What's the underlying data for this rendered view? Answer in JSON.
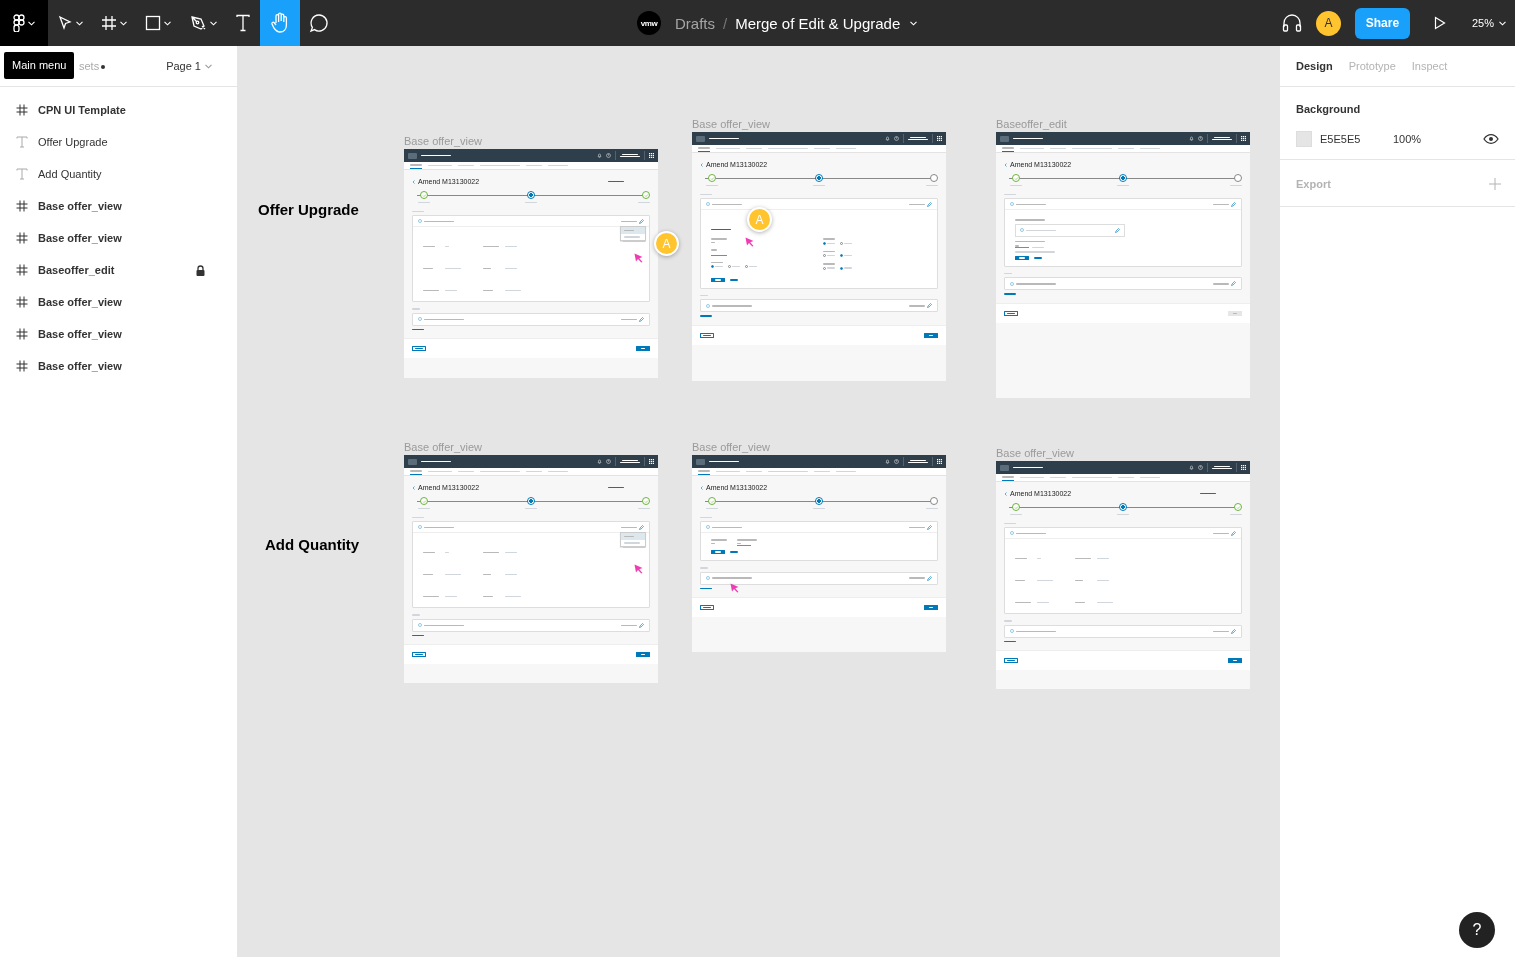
{
  "toolbar": {
    "tools": [
      {
        "kind": "logo",
        "caret": true,
        "selected": false
      },
      {
        "kind": "move",
        "caret": true,
        "selected": false
      },
      {
        "kind": "frame",
        "caret": true,
        "selected": false
      },
      {
        "kind": "shape",
        "caret": true,
        "selected": false
      },
      {
        "kind": "pen",
        "caret": true,
        "selected": false
      },
      {
        "kind": "text",
        "caret": false,
        "selected": false
      },
      {
        "kind": "hand",
        "caret": false,
        "selected": true
      },
      {
        "kind": "comment",
        "caret": false,
        "selected": false
      }
    ],
    "team_logo": "vmw",
    "breadcrumb": "Drafts",
    "separator": "/",
    "file_name": "Merge of Edit & Upgrade",
    "avatar": "A",
    "share": "Share",
    "zoom": "25%"
  },
  "tooltip": "Main menu",
  "left_panel": {
    "tab": "sets",
    "page": "Page 1",
    "layers": [
      {
        "kind": "frame",
        "name": "CPN UI Template",
        "locked": false
      },
      {
        "kind": "text",
        "name": "Offer Upgrade",
        "locked": false
      },
      {
        "kind": "text",
        "name": "Add Quantity",
        "locked": false
      },
      {
        "kind": "frame",
        "name": "Base offer_view",
        "locked": false
      },
      {
        "kind": "frame",
        "name": "Base offer_view",
        "locked": false
      },
      {
        "kind": "frame",
        "name": "Baseoffer_edit",
        "locked": true
      },
      {
        "kind": "frame",
        "name": "Base offer_view",
        "locked": false
      },
      {
        "kind": "frame",
        "name": "Base offer_view",
        "locked": false
      },
      {
        "kind": "frame",
        "name": "Base offer_view",
        "locked": false
      }
    ]
  },
  "canvas": {
    "labels": [
      "Offer Upgrade",
      "Add Quantity"
    ],
    "frames": [
      {
        "label": "Base offer_view",
        "title": "Amend M13130022",
        "add_link": true,
        "steps": [
          {
            "complete": true,
            "selected": false
          },
          {
            "complete": false,
            "selected": true
          },
          {
            "complete": true,
            "selected": false
          }
        ],
        "body": {
          "kind": "details"
        },
        "menu_open": true,
        "pointer": true,
        "badge": "A",
        "next_disabled": false
      },
      {
        "label": "Base offer_view",
        "title": "Amend M13130022",
        "add_link": false,
        "steps": [
          {
            "complete": true,
            "selected": false
          },
          {
            "complete": false,
            "selected": true
          },
          {
            "complete": false,
            "selected": false
          }
        ],
        "body": {
          "kind": "change-offer"
        },
        "menu_open": false,
        "pointer": true,
        "badge": "A",
        "next_disabled": false
      },
      {
        "label": "Baseoffer_edit",
        "title": "Amend M13130022",
        "add_link": false,
        "steps": [
          {
            "complete": true,
            "selected": false
          },
          {
            "complete": false,
            "selected": true
          },
          {
            "complete": false,
            "selected": false
          }
        ],
        "body": {
          "kind": "upgrade"
        },
        "menu_open": false,
        "pointer": false,
        "next_disabled": true
      },
      {
        "label": "Base offer_view",
        "title": "Amend M13130022",
        "add_link": true,
        "steps": [
          {
            "complete": true,
            "selected": false
          },
          {
            "complete": false,
            "selected": true
          },
          {
            "complete": true,
            "selected": false
          }
        ],
        "body": {
          "kind": "details"
        },
        "menu_open": true,
        "pointer": true,
        "next_disabled": false
      },
      {
        "label": "Base offer_view",
        "title": "Amend M13130022",
        "add_link": false,
        "steps": [
          {
            "complete": true,
            "selected": false
          },
          {
            "complete": false,
            "selected": true
          },
          {
            "complete": false,
            "selected": false
          }
        ],
        "body": {
          "kind": "add-quantity"
        },
        "menu_open": false,
        "pointer": true,
        "next_disabled": false
      },
      {
        "label": "Base offer_view",
        "title": "Amend M13130022",
        "add_link": true,
        "steps": [
          {
            "complete": true,
            "selected": false
          },
          {
            "complete": false,
            "selected": true
          },
          {
            "complete": true,
            "selected": false
          }
        ],
        "body": {
          "kind": "details"
        },
        "menu_open": false,
        "pointer": false,
        "next_disabled": false
      }
    ]
  },
  "right_panel": {
    "tabs": [
      {
        "label": "Design",
        "selected": true
      },
      {
        "label": "Prototype",
        "selected": false
      },
      {
        "label": "Inspect",
        "selected": false
      }
    ],
    "background": {
      "heading": "Background",
      "hex": "E5E5E5",
      "color": "#e5e5e5",
      "opacity": "100%"
    },
    "export": "Export",
    "help": "?"
  }
}
